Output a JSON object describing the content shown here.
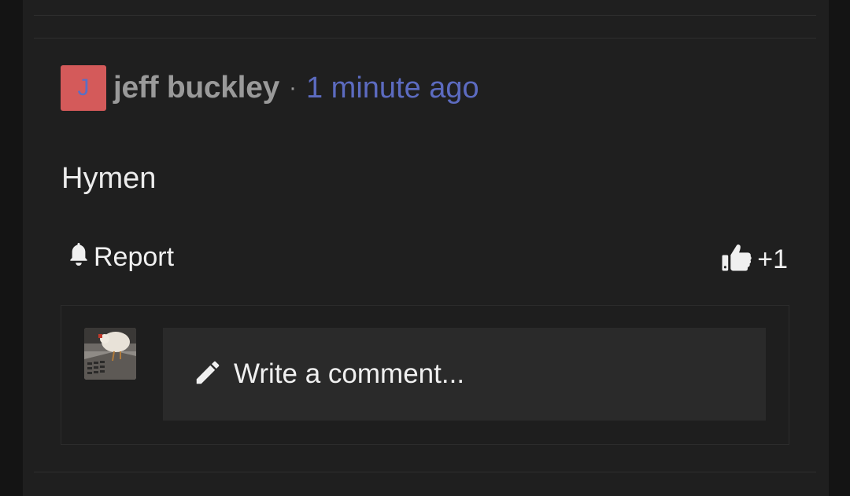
{
  "post": {
    "avatar_letter": "J",
    "author": "jeff buckley",
    "separator": "·",
    "time": "1 minute ago",
    "body": "Hymen"
  },
  "actions": {
    "report_label": "Report",
    "report_icon": "bell-icon",
    "like_label": "+1",
    "like_icon": "thumbs-up-icon"
  },
  "comment": {
    "placeholder": "Write a comment...",
    "icon": "pencil-icon"
  },
  "colors": {
    "background": "#141414",
    "panel": "#1f1f1f",
    "avatar_bg": "#d45a5a",
    "accent_link": "#5c6bc0",
    "muted_text": "#9a9a9a"
  }
}
